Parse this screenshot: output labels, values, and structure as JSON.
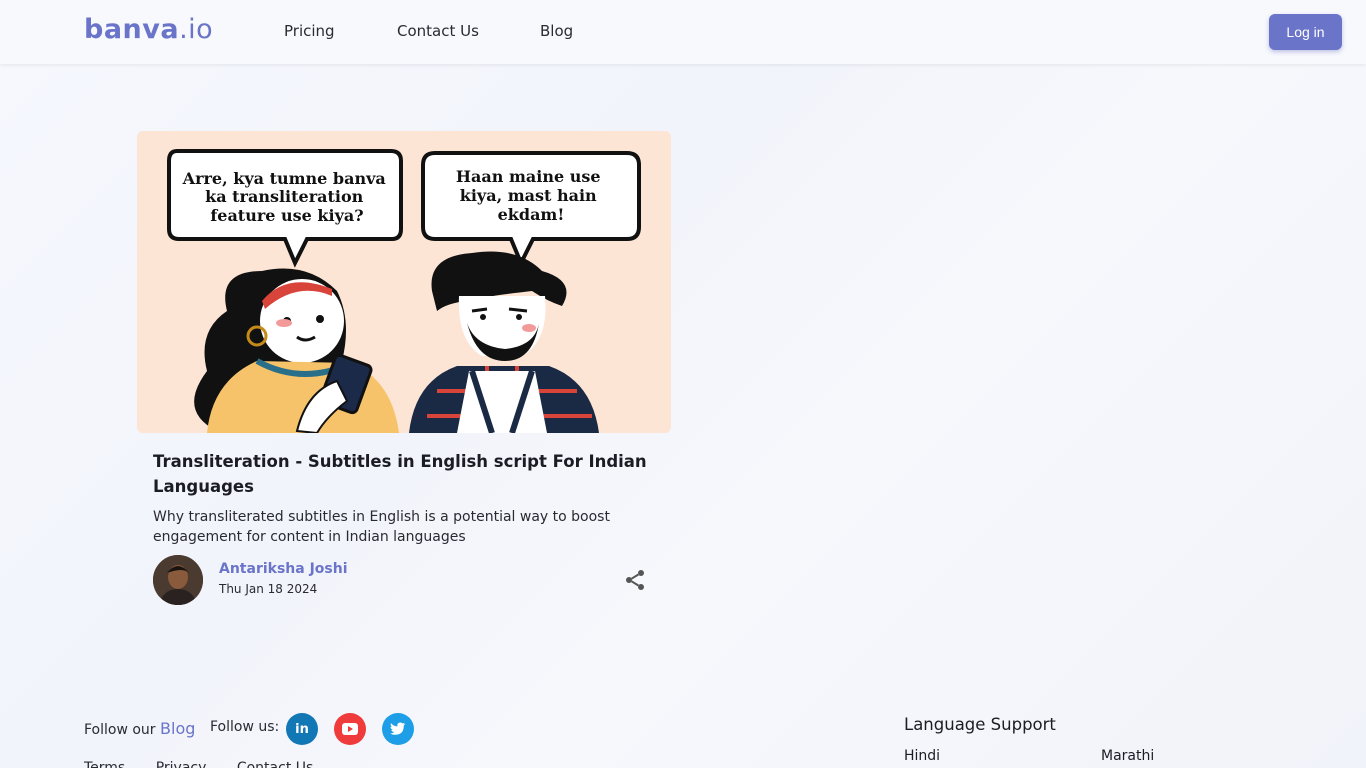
{
  "header": {
    "logo_main": "banva",
    "logo_tld": ".io",
    "nav": {
      "pricing": "Pricing",
      "contact": "Contact Us",
      "blog": "Blog"
    },
    "login_label": "Log in"
  },
  "post": {
    "cover": {
      "bubble_left": [
        "Arre, kya tumne banva",
        "ka transliteration",
        "feature use kiya?"
      ],
      "bubble_right": [
        "Haan maine use",
        "kiya, mast hain",
        "ekdam!"
      ]
    },
    "title": "Transliteration - Subtitles in English script For Indian Languages",
    "description": "Why transliterated subtitles in English is a potential way to boost engagement for content in Indian languages",
    "author": "Antariksha Joshi",
    "date": "Thu Jan 18 2024",
    "share_icon": "share-icon"
  },
  "footer": {
    "follow_our": "Follow our",
    "follow_blog_link": "Blog",
    "follow_us": "Follow us:",
    "social": {
      "linkedin": "in",
      "youtube_icon": "youtube-icon",
      "twitter_icon": "twitter-icon"
    },
    "links": [
      "Terms",
      "Privacy",
      "Contact Us"
    ],
    "language_heading": "Language Support",
    "languages": [
      "Hindi",
      "Marathi"
    ]
  },
  "colors": {
    "accent": "#6a74c9",
    "linkedin": "#1277b5",
    "youtube": "#ef3b3b",
    "twitter": "#1d9ee6"
  }
}
